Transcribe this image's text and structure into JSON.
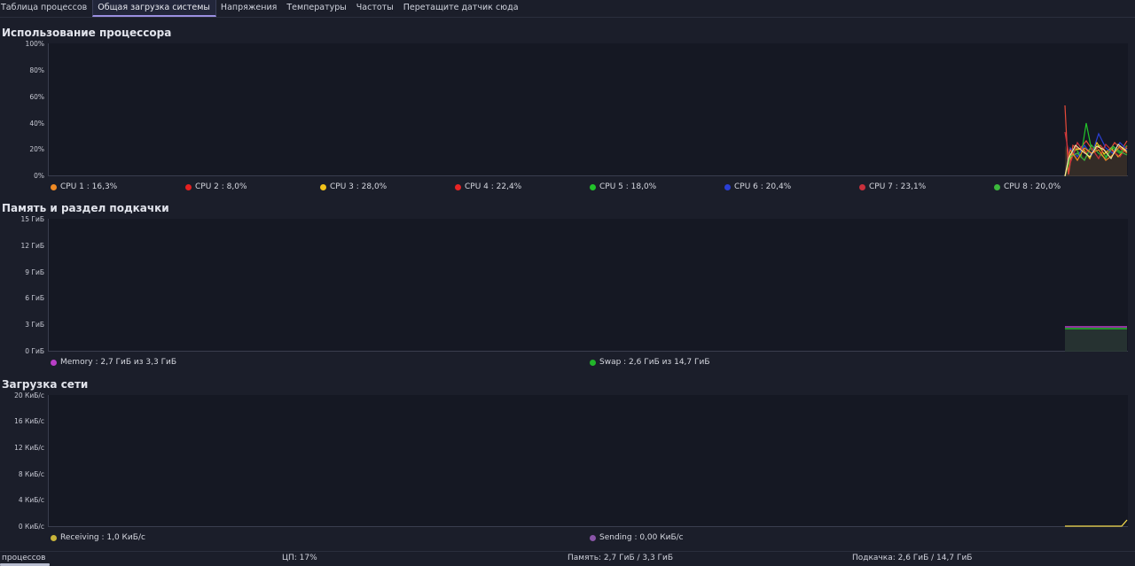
{
  "tabs": [
    {
      "label": "Таблица процессов",
      "active": false
    },
    {
      "label": "Общая загрузка системы",
      "active": true
    },
    {
      "label": "Напряжения",
      "active": false
    },
    {
      "label": "Температуры",
      "active": false
    },
    {
      "label": "Частоты",
      "active": false
    },
    {
      "label": "Перетащите датчик сюда",
      "active": false
    }
  ],
  "cpu": {
    "title": "Использование процессора",
    "yticks": [
      "100%",
      "80%",
      "60%",
      "40%",
      "20%",
      "0%"
    ],
    "legend": [
      {
        "label": "CPU 1 : 16,3%",
        "color": "#f08a24"
      },
      {
        "label": "CPU 2 : 8,0%",
        "color": "#e52020"
      },
      {
        "label": "CPU 3 : 28,0%",
        "color": "#f2c31a"
      },
      {
        "label": "CPU 4 : 22,4%",
        "color": "#e82424"
      },
      {
        "label": "CPU 5 : 18,0%",
        "color": "#22c32a"
      },
      {
        "label": "CPU 6 : 20,4%",
        "color": "#2a3fd6"
      },
      {
        "label": "CPU 7 : 23,1%",
        "color": "#c9303c"
      },
      {
        "label": "CPU 8 : 20,0%",
        "color": "#3cb83c"
      }
    ]
  },
  "memory": {
    "title": "Память и раздел подкачки",
    "yticks": [
      "15 ГиБ",
      "12 ГиБ",
      "9 ГиБ",
      "6 ГиБ",
      "3 ГиБ",
      "0 ГиБ"
    ],
    "legend": [
      {
        "label": "Memory : 2,7 ГиБ из 3,3 ГиБ",
        "color": "#b93ec7"
      },
      {
        "label": "Swap : 2,6 ГиБ из 14,7 ГиБ",
        "color": "#22b52a"
      }
    ]
  },
  "network": {
    "title": "Загрузка сети",
    "yticks": [
      "20 КиБ/с",
      "16 КиБ/с",
      "12 КиБ/с",
      "8 КиБ/с",
      "4 КиБ/с",
      "0 КиБ/с"
    ],
    "legend": [
      {
        "label": "Receiving : 1,0 КиБ/с",
        "color": "#c8b43a"
      },
      {
        "label": "Sending : 0,00 КиБ/с",
        "color": "#8a55a8"
      }
    ]
  },
  "status": {
    "processes": "процессов",
    "cpu": "ЦП: 17%",
    "memory": "Память: 2,7 ГиБ / 3,3 ГиБ",
    "swap": "Подкачка: 2,6 ГиБ / 14,7 ГиБ"
  }
}
